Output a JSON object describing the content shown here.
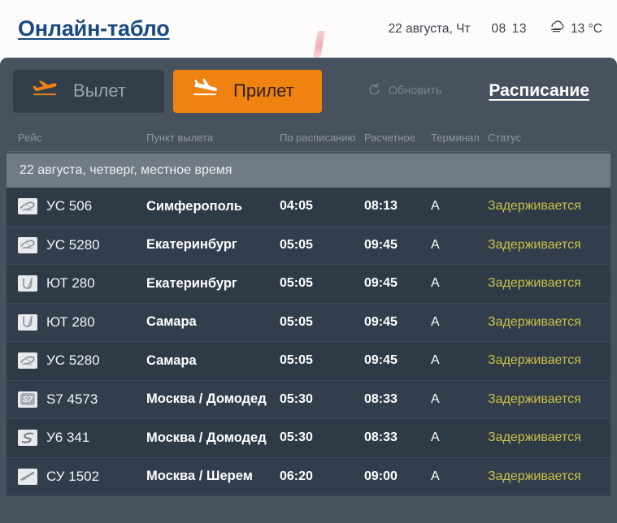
{
  "header": {
    "title": "Онлайн-табло",
    "date": "22 августа, Чт",
    "clock_hours": "08",
    "clock_minutes": "13",
    "weather_icon": "fog-cloud-icon",
    "temperature": "13 °C"
  },
  "tabs": [
    {
      "id": "departure",
      "label": "Вылет",
      "icon": "plane-takeoff-icon",
      "active": false
    },
    {
      "id": "arrival",
      "label": "Прилет",
      "icon": "plane-landing-icon",
      "active": true
    }
  ],
  "tools": {
    "refresh_label": "Обновить",
    "refresh_icon": "refresh-circle-icon",
    "schedule_label": "Расписание"
  },
  "columns": {
    "flight": "Рейс",
    "point": "Пункт вылета",
    "scheduled": "По расписанию",
    "estimated": "Расчетное",
    "terminal": "Терминал",
    "status": "Статус"
  },
  "date_banner": "22 августа, четверг, местное время",
  "colors": {
    "accent_orange": "#f08211",
    "board_frame": "#48525e",
    "row_bg": "#2f3a47",
    "row_bg_alt": "#333e4c",
    "status_delayed": "#c9c048",
    "title_blue": "#1b4a82",
    "banner_grey": "#717b86"
  },
  "flights": [
    {
      "airline_logo": "uvt-aero-logo",
      "flight": "УС 506",
      "point": "Симферополь",
      "scheduled": "04:05",
      "estimated": "08:13",
      "terminal": "A",
      "status": "Задерживается"
    },
    {
      "airline_logo": "uvt-aero-logo",
      "flight": "УС 5280",
      "point": "Екатеринбург",
      "scheduled": "05:05",
      "estimated": "09:45",
      "terminal": "A",
      "status": "Задерживается"
    },
    {
      "airline_logo": "utair-logo",
      "flight": "ЮТ 280",
      "point": "Екатеринбург",
      "scheduled": "05:05",
      "estimated": "09:45",
      "terminal": "A",
      "status": "Задерживается"
    },
    {
      "airline_logo": "utair-logo",
      "flight": "ЮТ 280",
      "point": "Самара",
      "scheduled": "05:05",
      "estimated": "09:45",
      "terminal": "A",
      "status": "Задерживается"
    },
    {
      "airline_logo": "uvt-aero-logo",
      "flight": "УС 5280",
      "point": "Самара",
      "scheduled": "05:05",
      "estimated": "09:45",
      "terminal": "A",
      "status": "Задерживается"
    },
    {
      "airline_logo": "s7-logo",
      "flight": "S7 4573",
      "point": "Москва / Домодед",
      "scheduled": "05:30",
      "estimated": "08:33",
      "terminal": "A",
      "status": "Задерживается"
    },
    {
      "airline_logo": "ural-airlines-logo",
      "flight": "У6 341",
      "point": "Москва / Домодед",
      "scheduled": "05:30",
      "estimated": "08:33",
      "terminal": "A",
      "status": "Задерживается"
    },
    {
      "airline_logo": "aeroflot-logo",
      "flight": "СУ 1502",
      "point": "Москва / Шерем",
      "scheduled": "06:20",
      "estimated": "09:00",
      "terminal": "A",
      "status": "Задерживается"
    }
  ]
}
